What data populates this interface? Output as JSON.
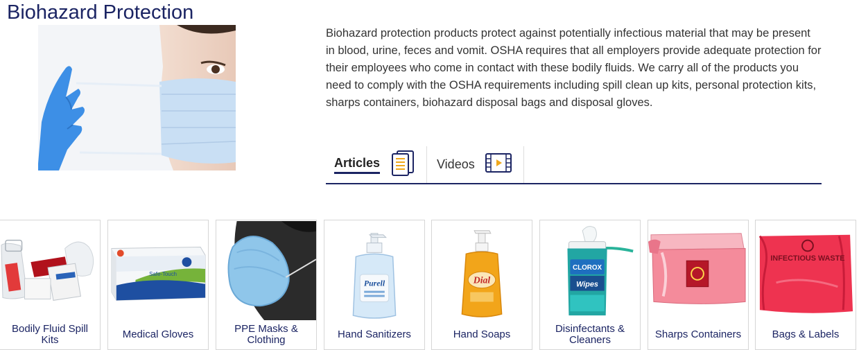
{
  "page": {
    "title": "Biohazard Protection",
    "description": "Biohazard protection products protect against potentially infectious material that may be present in blood, urine, feces and vomit. OSHA requires that all employers provide adequate protection for their employees who come in contact with these bodily fluids. We carry all of the products you need to comply with the OSHA requirements including spill clean up kits, personal protection kits, sharps containers, biohazard disposal bags and disposal gloves."
  },
  "tabs": [
    {
      "label": "Articles",
      "icon": "articles-icon",
      "active": true
    },
    {
      "label": "Videos",
      "icon": "video-icon",
      "active": false
    }
  ],
  "categories": [
    {
      "label": "Bodily Fluid Spill Kits",
      "image": "spill-kit"
    },
    {
      "label": "Medical Gloves",
      "image": "glove-box"
    },
    {
      "label": "PPE Masks & Clothing",
      "image": "face-mask"
    },
    {
      "label": "Hand Sanitizers",
      "image": "purell-bottle"
    },
    {
      "label": "Hand Soaps",
      "image": "dial-soap"
    },
    {
      "label": "Disinfectants & Cleaners",
      "image": "clorox-wipes"
    },
    {
      "label": "Sharps Containers",
      "image": "sharps-container"
    },
    {
      "label": "Bags & Labels",
      "image": "biohazard-bag"
    }
  ],
  "imagery": {
    "infectious_bag_text": "INFECTIOUS WASTE",
    "purell_brand": "Purell",
    "dial_brand": "Dial",
    "clorox_brand": "CLOROX",
    "clorox_product": "Wipes",
    "glove_brand": "Safe-Touch"
  },
  "colors": {
    "title": "#1b2463",
    "accent": "#1b2463",
    "icon_gold": "#f0a81c",
    "glove_blue": "#3d8fe6",
    "bag_red": "#e8102c"
  }
}
